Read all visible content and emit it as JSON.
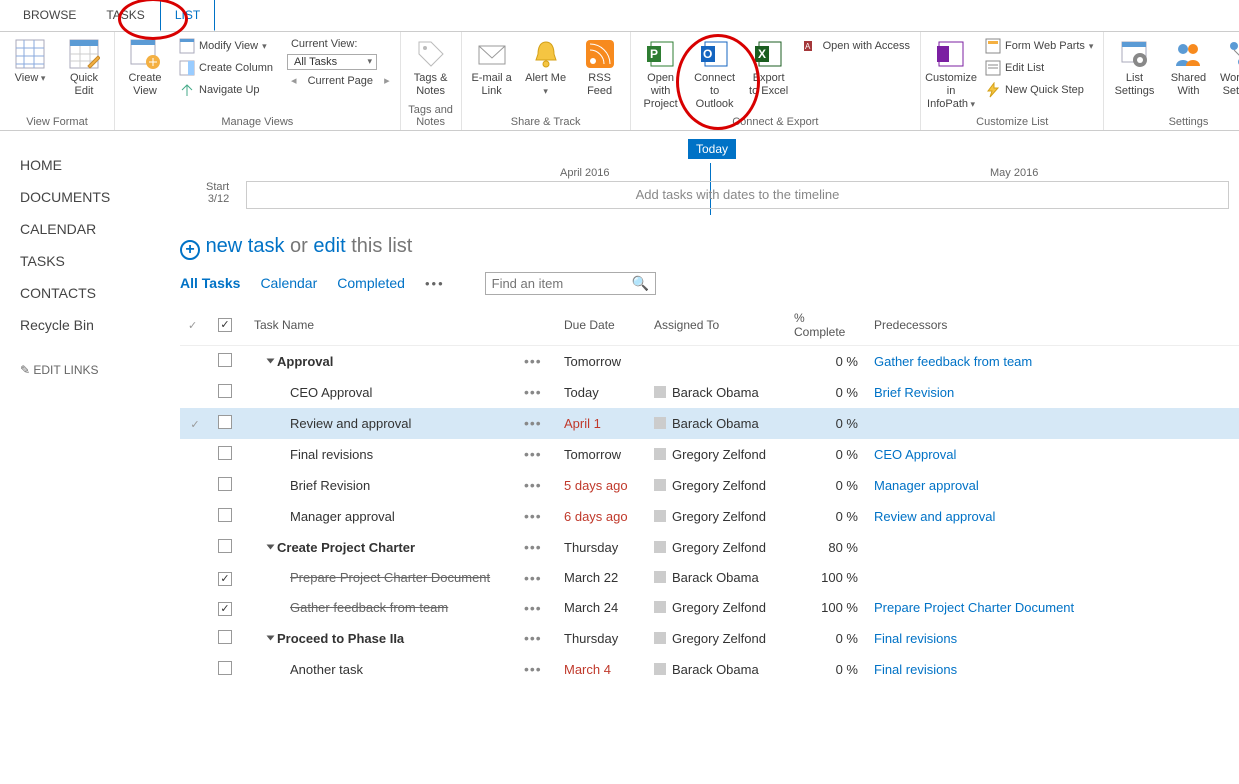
{
  "tabs": {
    "browse": "BROWSE",
    "tasks": "TASKS",
    "list": "LIST"
  },
  "ribbon": {
    "view_format": {
      "view": "View",
      "quick_edit": "Quick Edit",
      "label": "View Format"
    },
    "manage_views": {
      "create_view": "Create View",
      "modify_view": "Modify View",
      "create_column": "Create Column",
      "navigate_up": "Navigate Up",
      "current_view_label": "Current View:",
      "current_view_value": "All Tasks",
      "current_page": "Current Page",
      "label": "Manage Views"
    },
    "tags_notes": {
      "tags_notes": "Tags & Notes",
      "label": "Tags and Notes"
    },
    "share_track": {
      "email_link": "E-mail a Link",
      "alert_me": "Alert Me",
      "rss": "RSS Feed",
      "label": "Share & Track"
    },
    "connect_export": {
      "open_project": "Open with Project",
      "connect_outlook": "Connect to Outlook",
      "export_excel": "Export to Excel",
      "open_access": "Open with Access",
      "label": "Connect & Export"
    },
    "customize": {
      "customize_infopath": "Customize in InfoPath",
      "form_web_parts": "Form Web Parts",
      "edit_list": "Edit List",
      "new_quick_step": "New Quick Step",
      "label": "Customize List"
    },
    "settings": {
      "list_settings": "List Settings",
      "shared_with": "Shared With",
      "workflow_settings": "Workflow Settings",
      "label": "Settings"
    }
  },
  "sidebar": {
    "items": [
      {
        "label": "HOME"
      },
      {
        "label": "DOCUMENTS"
      },
      {
        "label": "CALENDAR"
      },
      {
        "label": "TASKS"
      },
      {
        "label": "CONTACTS"
      },
      {
        "label": "Recycle Bin"
      }
    ],
    "edit_links": "EDIT LINKS"
  },
  "timeline": {
    "today": "Today",
    "april": "April 2016",
    "may": "May 2016",
    "start_label": "Start",
    "start_date": "3/12",
    "placeholder": "Add tasks with dates to the timeline"
  },
  "newtask": {
    "new_task": "new task",
    "or": " or ",
    "edit": "edit",
    "this_list": " this list"
  },
  "views": {
    "all_tasks": "All Tasks",
    "calendar": "Calendar",
    "completed": "Completed"
  },
  "search": {
    "placeholder": "Find an item"
  },
  "columns": {
    "task_name": "Task Name",
    "due_date": "Due Date",
    "assigned_to": "Assigned To",
    "pct_complete": "% Complete",
    "predecessors": "Predecessors"
  },
  "tasks": [
    {
      "done": false,
      "checked": false,
      "name": "Approval",
      "group": true,
      "due": "Tomorrow",
      "overdue": false,
      "assigned": "",
      "pct": "0 %",
      "pred": "Gather feedback from team",
      "hl": false,
      "indent": 1
    },
    {
      "done": false,
      "checked": false,
      "name": "CEO Approval",
      "group": false,
      "due": "Today",
      "overdue": false,
      "assigned": "Barack Obama",
      "pct": "0 %",
      "pred": "Brief Revision",
      "hl": false,
      "indent": 2
    },
    {
      "done": true,
      "checked": false,
      "name": "Review and approval",
      "group": false,
      "due": "April 1",
      "overdue": true,
      "assigned": "Barack Obama",
      "pct": "0 %",
      "pred": "",
      "hl": true,
      "indent": 2
    },
    {
      "done": false,
      "checked": false,
      "name": "Final revisions",
      "group": false,
      "due": "Tomorrow",
      "overdue": false,
      "assigned": "Gregory Zelfond",
      "pct": "0 %",
      "pred": "CEO Approval",
      "hl": false,
      "indent": 2
    },
    {
      "done": false,
      "checked": false,
      "name": "Brief Revision",
      "group": false,
      "due": "5 days ago",
      "overdue": true,
      "assigned": "Gregory Zelfond",
      "pct": "0 %",
      "pred": "Manager approval",
      "hl": false,
      "indent": 2
    },
    {
      "done": false,
      "checked": false,
      "name": "Manager approval",
      "group": false,
      "due": "6 days ago",
      "overdue": true,
      "assigned": "Gregory Zelfond",
      "pct": "0 %",
      "pred": "Review and approval",
      "hl": false,
      "indent": 2
    },
    {
      "done": false,
      "checked": false,
      "name": "Create Project Charter",
      "group": true,
      "due": "Thursday",
      "overdue": false,
      "assigned": "Gregory Zelfond",
      "pct": "80 %",
      "pred": "",
      "hl": false,
      "indent": 1
    },
    {
      "done": false,
      "checked": true,
      "name": "Prepare Project Charter Document",
      "group": false,
      "strike": true,
      "due": "March 22",
      "overdue": false,
      "assigned": "Barack Obama",
      "pct": "100 %",
      "pred": "",
      "hl": false,
      "indent": 2
    },
    {
      "done": false,
      "checked": true,
      "name": "Gather feedback from team",
      "group": false,
      "strike": true,
      "due": "March 24",
      "overdue": false,
      "assigned": "Gregory Zelfond",
      "pct": "100 %",
      "pred": "Prepare Project Charter Document",
      "hl": false,
      "indent": 2
    },
    {
      "done": false,
      "checked": false,
      "name": "Proceed to Phase IIa",
      "group": true,
      "due": "Thursday",
      "overdue": false,
      "assigned": "Gregory Zelfond",
      "pct": "0 %",
      "pred": "Final revisions",
      "hl": false,
      "indent": 1
    },
    {
      "done": false,
      "checked": false,
      "name": "Another task",
      "group": false,
      "due": "March 4",
      "overdue": true,
      "assigned": "Barack Obama",
      "pct": "0 %",
      "pred": "Final revisions",
      "hl": false,
      "indent": 2
    }
  ]
}
